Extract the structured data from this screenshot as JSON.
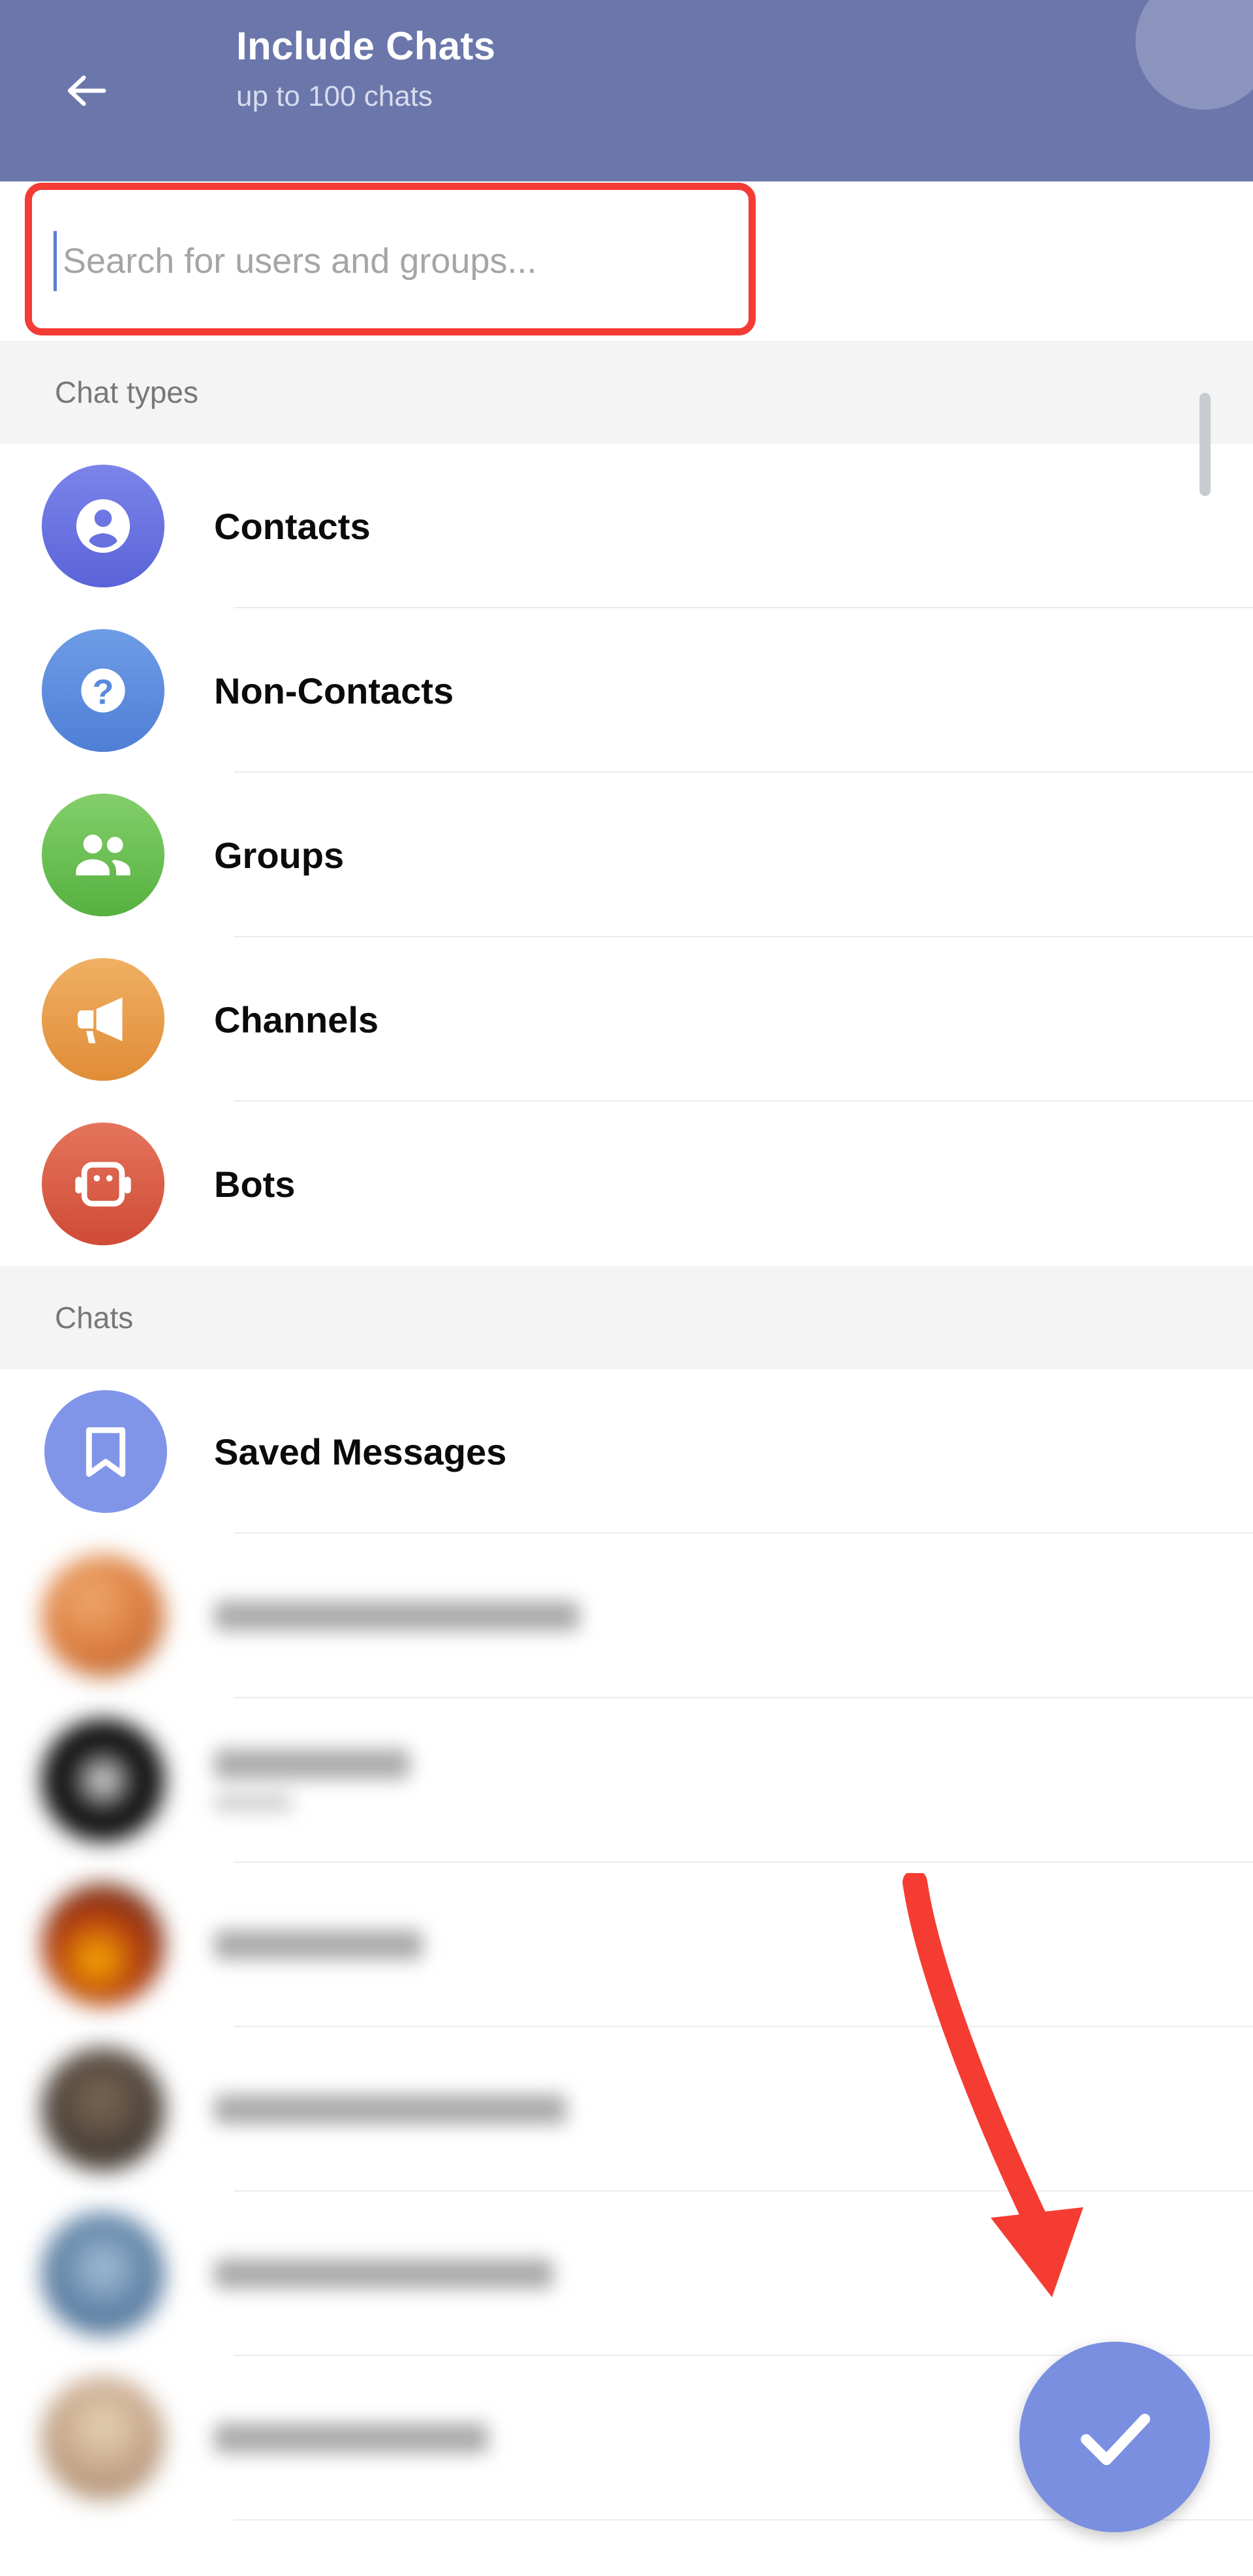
{
  "header": {
    "back_icon": "back-arrow-icon",
    "title": "Include Chats",
    "subtitle": "up to 100 chats",
    "background_color": "#6b77ab"
  },
  "search": {
    "value": "",
    "placeholder": "Search for users and groups...",
    "highlight_color": "#f43b35",
    "caret_color": "#5b7bd5"
  },
  "sections": [
    {
      "title": "Chat types",
      "items": [
        {
          "label": "Contacts",
          "icon": "person-icon",
          "color": "#6b75e0"
        },
        {
          "label": "Non-Contacts",
          "icon": "question-icon",
          "color": "#5a8ade"
        },
        {
          "label": "Groups",
          "icon": "people-icon",
          "color": "#6bbd52"
        },
        {
          "label": "Channels",
          "icon": "megaphone-icon",
          "color": "#e8a04a"
        },
        {
          "label": "Bots",
          "icon": "robot-icon",
          "color": "#da5c45"
        }
      ]
    },
    {
      "title": "Chats",
      "items": [
        {
          "label": "Saved Messages",
          "icon": "bookmark-icon",
          "color": "#8095e8"
        }
      ]
    }
  ],
  "blurred_chats": [
    {
      "name_width": 560,
      "sub_width": 0,
      "avatar_color": "#e8a26a",
      "has_sub": false
    },
    {
      "name_width": 300,
      "sub_width": 120,
      "avatar_color": "#1a1a1a",
      "has_sub": true
    },
    {
      "name_width": 320,
      "sub_width": 0,
      "avatar_color": "#6b4a2f",
      "has_sub": false
    },
    {
      "name_width": 540,
      "sub_width": 0,
      "avatar_color": "#4a4038",
      "has_sub": false
    },
    {
      "name_width": 520,
      "sub_width": 0,
      "avatar_color": "#5c7fa3",
      "has_sub": false
    },
    {
      "name_width": 420,
      "sub_width": 0,
      "avatar_color": "#c2a286",
      "has_sub": false
    }
  ],
  "fab": {
    "icon": "check-icon",
    "color": "#7b8fe0",
    "label": "Done"
  },
  "annotation": {
    "arrow_color": "#f53c32",
    "target": "done-fab-button"
  },
  "scrollbar": {
    "color": "#c8cbcf"
  }
}
